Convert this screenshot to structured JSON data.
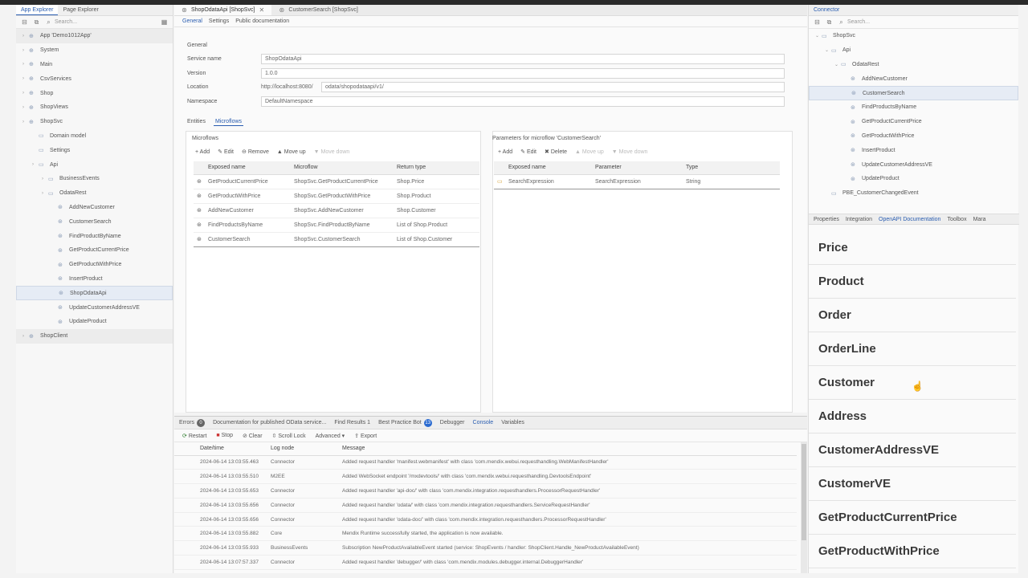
{
  "left_panel": {
    "tabs": [
      "App Explorer",
      "Page Explorer"
    ],
    "search_placeholder": "Search...",
    "tree": [
      {
        "label": "App 'Demo1012App'",
        "indent": 0,
        "root": true
      },
      {
        "label": "System",
        "indent": 0
      },
      {
        "label": "Main",
        "indent": 0
      },
      {
        "label": "CsvServices",
        "indent": 0
      },
      {
        "label": "Shop",
        "indent": 0
      },
      {
        "label": "ShopViews",
        "indent": 0
      },
      {
        "label": "ShopSvc",
        "indent": 0
      },
      {
        "label": "Domain model",
        "indent": 1
      },
      {
        "label": "Settings",
        "indent": 1
      },
      {
        "label": "Api",
        "indent": 1
      },
      {
        "label": "BusinessEvents",
        "indent": 2
      },
      {
        "label": "OdataRest",
        "indent": 2
      },
      {
        "label": "AddNewCustomer",
        "indent": 3
      },
      {
        "label": "CustomerSearch",
        "indent": 3
      },
      {
        "label": "FindProductByName",
        "indent": 3
      },
      {
        "label": "GetProductCurrentPrice",
        "indent": 3
      },
      {
        "label": "GetProductWithPrice",
        "indent": 3
      },
      {
        "label": "InsertProduct",
        "indent": 3
      },
      {
        "label": "ShopOdataApi",
        "indent": 3,
        "selected": true
      },
      {
        "label": "UpdateCustomerAddressVE",
        "indent": 3
      },
      {
        "label": "UpdateProduct",
        "indent": 3
      },
      {
        "label": "ShopClient",
        "indent": 0,
        "root": true
      }
    ]
  },
  "doc_tabs": [
    "ShopOdataApi [ShopSvc]",
    "CustomerSearch [ShopSvc]"
  ],
  "sub_tabs": [
    "General",
    "Settings",
    "Public documentation"
  ],
  "general": {
    "group": "General",
    "service_name_label": "Service name",
    "service_name": "ShopOdataApi",
    "version_label": "Version",
    "version": "1.0.0",
    "location_label": "Location",
    "location_base": "http://localhost:8080/",
    "location_path": "odata/shopodataapi/v1/",
    "namespace_label": "Namespace",
    "namespace": "DefaultNamespace"
  },
  "inner_tabs": [
    "Entities",
    "Microflows"
  ],
  "microflows": {
    "title": "Microflows",
    "tools": [
      "Add",
      "Edit",
      "Remove",
      "Move up",
      "Move down"
    ],
    "headers": [
      "Exposed name",
      "Microflow",
      "Return type"
    ],
    "rows": [
      [
        "GetProductCurrentPrice",
        "ShopSvc.GetProductCurrentPrice",
        "Shop.Price"
      ],
      [
        "GetProductWithPrice",
        "ShopSvc.GetProductWithPrice",
        "Shop.Product"
      ],
      [
        "AddNewCustomer",
        "ShopSvc.AddNewCustomer",
        "Shop.Customer"
      ],
      [
        "FindProductsByName",
        "ShopSvc.FindProductByName",
        "List of Shop.Product"
      ],
      [
        "CustomerSearch",
        "ShopSvc.CustomerSearch",
        "List of Shop.Customer"
      ]
    ]
  },
  "parameters": {
    "title": "Parameters for microflow 'CustomerSearch'",
    "tools": [
      "Add",
      "Edit",
      "Delete",
      "Move up",
      "Move down"
    ],
    "headers": [
      "Exposed name",
      "Parameter",
      "Type"
    ],
    "rows": [
      [
        "SearchExpression",
        "SearchExpression",
        "String"
      ]
    ]
  },
  "bottom": {
    "tabs": [
      "Errors",
      "Documentation for published OData service...",
      "Find Results 1",
      "Best Practice Bot",
      "Debugger",
      "Console",
      "Variables"
    ],
    "errors_count": "0",
    "bestpractice_count": "13",
    "tools": [
      "Restart",
      "Stop",
      "Clear",
      "Scroll Lock",
      "Advanced",
      "Export"
    ],
    "headers": [
      "Date/time",
      "Log node",
      "Message"
    ],
    "rows": [
      [
        "2024-06-14 13:03:55.463",
        "Connector",
        "Added request handler 'manifest.webmanifest' with class 'com.mendix.webui.requesthandling.WebManifestHandler'"
      ],
      [
        "2024-06-14 13:03:55.510",
        "M2EE",
        "Added WebSocket endpoint '/mxdevtools/' with class 'com.mendix.webui.requesthandling.DevtoolsEndpoint'"
      ],
      [
        "2024-06-14 13:03:55.653",
        "Connector",
        "Added request handler 'api-doc/' with class 'com.mendix.integration.requesthandlers.ProcessorRequestHandler'"
      ],
      [
        "2024-06-14 13:03:55.656",
        "Connector",
        "Added request handler 'odata/' with class 'com.mendix.integration.requesthandlers.ServiceRequestHandler'"
      ],
      [
        "2024-06-14 13:03:55.656",
        "Connector",
        "Added request handler 'odata-doc/' with class 'com.mendix.integration.requesthandlers.ProcessorRequestHandler'"
      ],
      [
        "2024-06-14 13:03:55.882",
        "Core",
        "Mendix Runtime successfully started, the application is now available."
      ],
      [
        "2024-06-14 13:03:55.933",
        "BusinessEvents",
        "Subscription NewProductAvailableEvent started (service: ShopEvents / handler: ShopClient.Handle_NewProductAvailableEvent)"
      ],
      [
        "2024-06-14 13:07:57.337",
        "Connector",
        "Added request handler 'debugger/' with class 'com.mendix.modules.debugger.internal.DebuggerHandler'"
      ]
    ]
  },
  "right_panel": {
    "title": "Connector",
    "search_placeholder": "Search...",
    "tree": [
      {
        "label": "ShopSvc",
        "indent": 0
      },
      {
        "label": "Api",
        "indent": 1
      },
      {
        "label": "OdataRest",
        "indent": 2
      },
      {
        "label": "AddNewCustomer",
        "indent": 3
      },
      {
        "label": "CustomerSearch",
        "indent": 3,
        "selected": true
      },
      {
        "label": "FindProductsByName",
        "indent": 3
      },
      {
        "label": "GetProductCurrentPrice",
        "indent": 3
      },
      {
        "label": "GetProductWithPrice",
        "indent": 3
      },
      {
        "label": "InsertProduct",
        "indent": 3
      },
      {
        "label": "UpdateCustomerAddressVE",
        "indent": 3
      },
      {
        "label": "UpdateProduct",
        "indent": 3
      },
      {
        "label": "PBE_CustomerChangedEvent",
        "indent": 1
      }
    ],
    "tabs": [
      "Properties",
      "Integration",
      "OpenAPI Documentation",
      "Toolbox",
      "Mara"
    ],
    "schemas": [
      "Price",
      "Product",
      "Order",
      "OrderLine",
      "Customer",
      "Address",
      "CustomerAddressVE",
      "CustomerVE",
      "GetProductCurrentPrice",
      "GetProductWithPrice"
    ]
  },
  "colors": {
    "accent": "#2a5db0",
    "selection": "#e6ecf5"
  }
}
